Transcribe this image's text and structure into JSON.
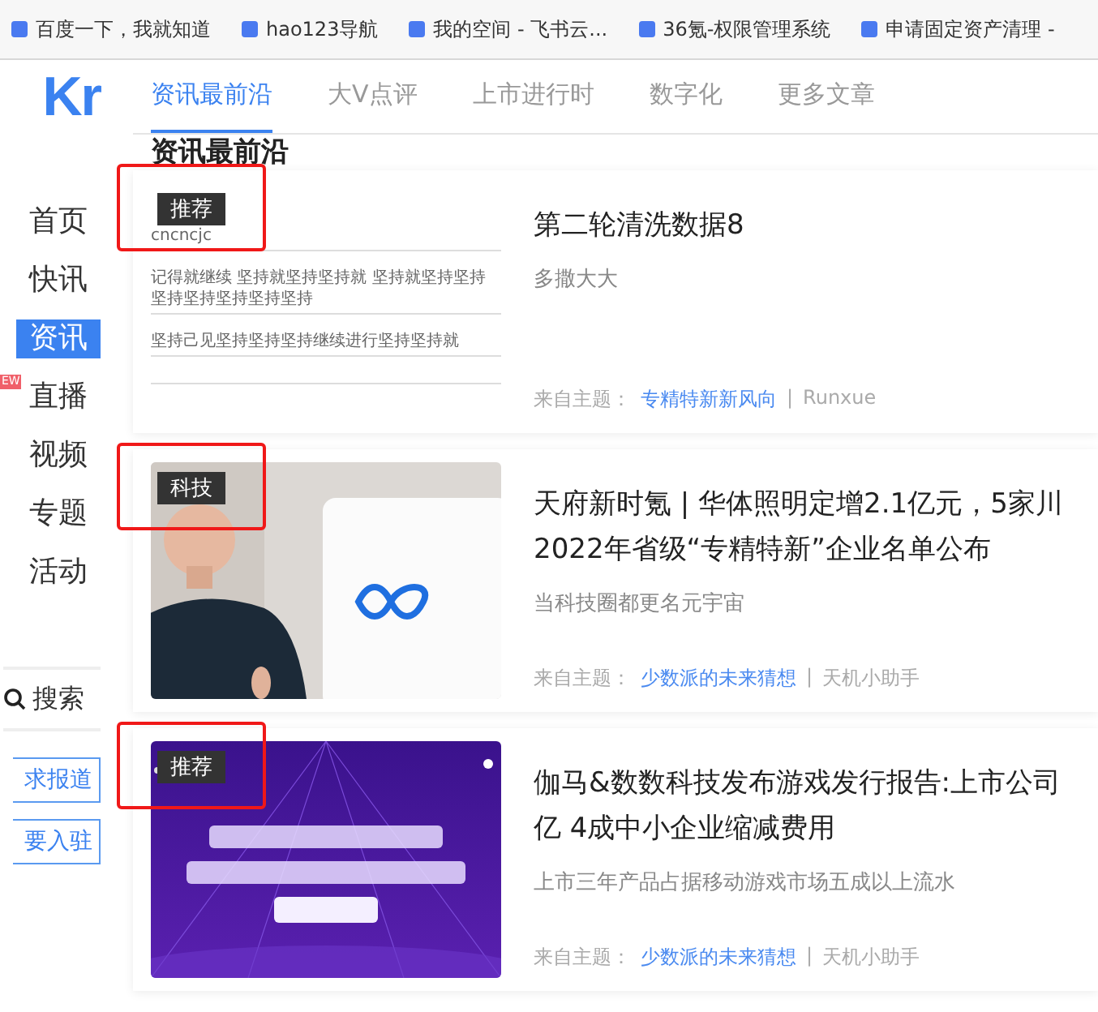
{
  "bookmarks": [
    {
      "label": "百度一下，我就知道"
    },
    {
      "label": "hao123导航"
    },
    {
      "label": "我的空间 - 飞书云..."
    },
    {
      "label": "36氪-权限管理系统"
    },
    {
      "label": "申请固定资产清理 -"
    }
  ],
  "logo": "Kr",
  "sidebar": {
    "items": [
      {
        "label": "首页",
        "selected": false
      },
      {
        "label": "快讯",
        "selected": false
      },
      {
        "label": "资讯",
        "selected": true
      },
      {
        "label": "直播",
        "selected": false,
        "badge": "EW"
      },
      {
        "label": "视频",
        "selected": false
      },
      {
        "label": "专题",
        "selected": false
      },
      {
        "label": "活动",
        "selected": false
      }
    ],
    "search": "搜索",
    "buttons": [
      "求报道",
      "要入驻"
    ]
  },
  "tabs": [
    {
      "label": "资讯最前沿",
      "selected": true
    },
    {
      "label": "大V点评",
      "selected": false
    },
    {
      "label": "上市进行时",
      "selected": false
    },
    {
      "label": "数字化",
      "selected": false
    },
    {
      "label": "更多文章",
      "selected": false
    }
  ],
  "heading": "资讯最前沿",
  "articles": [
    {
      "tag": "推荐",
      "highlighted": true,
      "thumb": {
        "kind": "document",
        "lines": [
          "cncncjc",
          "记得就继续 坚持就坚持坚持就 坚持就坚持坚持坚持坚持坚持坚持坚持",
          "坚持己见坚持坚持坚持继续进行坚持坚持就"
        ]
      },
      "title_lines": [
        "第二轮清洗数据8"
      ],
      "summary": "多撒大大",
      "meta_label": "来自主题：",
      "topic": "专精特新新风向",
      "separator": "|",
      "author": "Runxue"
    },
    {
      "tag": "科技",
      "highlighted": true,
      "thumb": {
        "kind": "picture"
      },
      "title_lines": [
        "天府新时氪 | 华体照明定增2.1亿元，5家川",
        "2022年省级“专精特新”企业名单公布"
      ],
      "summary": "当科技圈都更名元宇宙",
      "meta_label": "来自主题：",
      "topic": "少数派的未来猜想",
      "separator": "|",
      "author": "天机小助手"
    },
    {
      "tag": "推荐",
      "highlighted": true,
      "thumb": {
        "kind": "poster"
      },
      "title_lines": [
        "伽马&数数科技发布游戏发行报告:上市公司",
        "亿 4成中小企业缩减费用"
      ],
      "summary": "上市三年产品占据移动游戏市场五成以上流水",
      "meta_label": "来自主题：",
      "topic": "少数派的未来猜想",
      "separator": "|",
      "author": "天机小助手"
    }
  ]
}
